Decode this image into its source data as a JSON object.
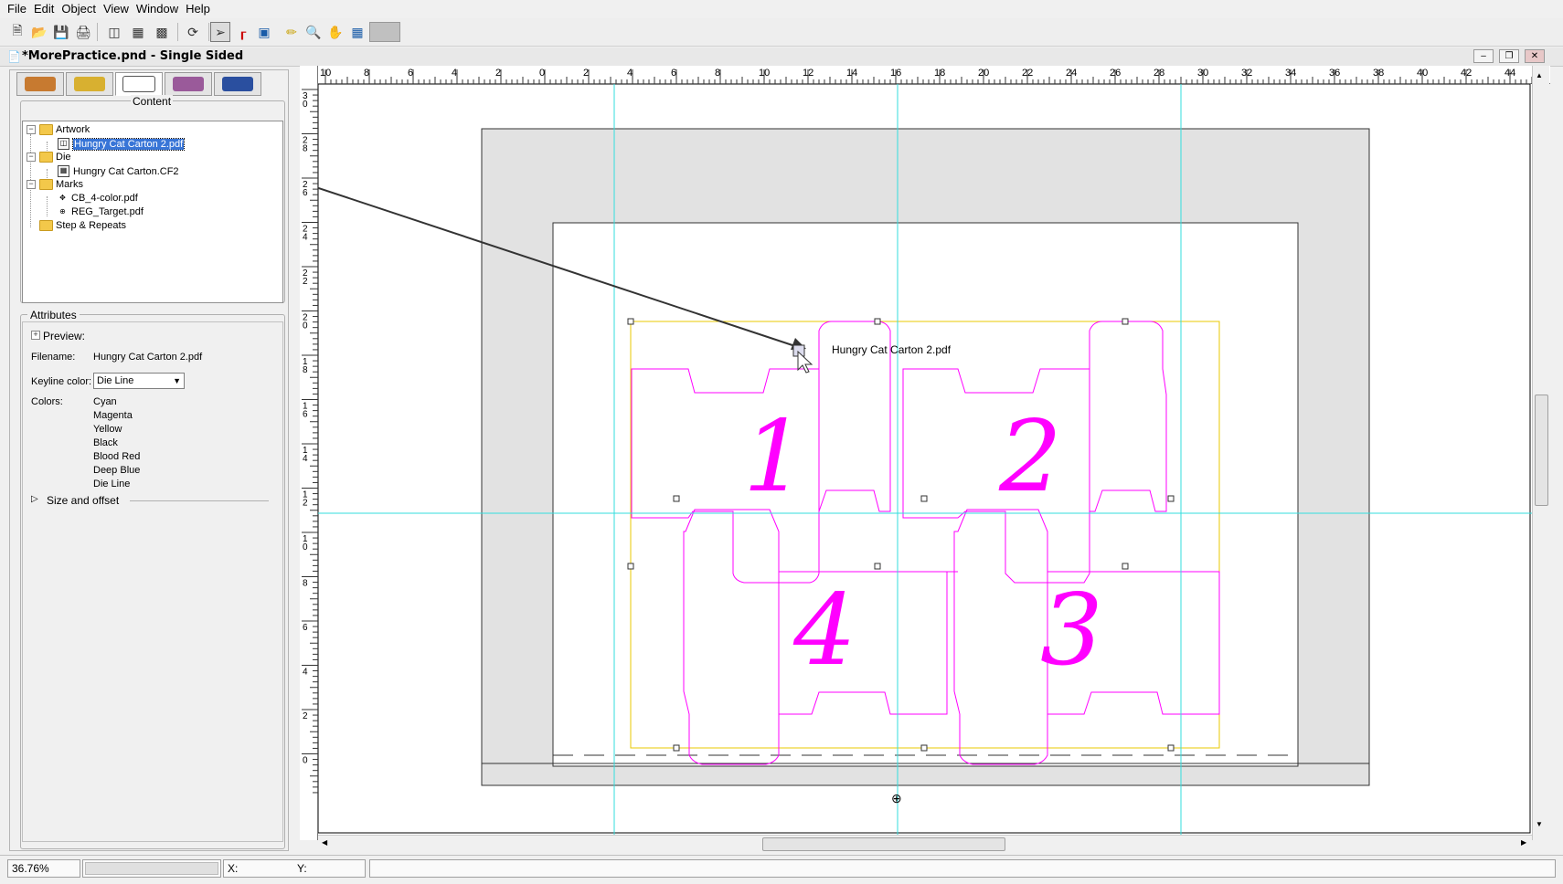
{
  "menu": [
    "File",
    "Edit",
    "Object",
    "View",
    "Window",
    "Help"
  ],
  "toolbar": {
    "icons": [
      "new-document-icon",
      "open-folder-icon",
      "save-icon",
      "print-icon",
      "artwork-icon",
      "die-icon",
      "mark-icon",
      "refresh-icon",
      "pointer-tool-icon",
      "crop-tool-icon",
      "align-tool-icon",
      "ruler-tool-icon",
      "zoom-tool-icon",
      "hand-tool-icon",
      "grid-tool-icon",
      "color-swatch-icon"
    ]
  },
  "document": {
    "title": "*MorePractice.pnd - Single Sided"
  },
  "panel_tabs": [
    "info-tab",
    "marks-tab",
    "content-tab",
    "layout-tab",
    "properties-tab"
  ],
  "content": {
    "legend": "Content",
    "tree": {
      "artwork": "Artwork",
      "artwork_file": "Hungry Cat Carton 2.pdf",
      "die": "Die",
      "die_file": "Hungry Cat Carton.CF2",
      "marks": "Marks",
      "mark1": "CB_4-color.pdf",
      "mark2": "REG_Target.pdf",
      "step": "Step & Repeats"
    }
  },
  "attributes": {
    "legend": "Attributes",
    "preview": "Preview:",
    "filename_label": "Filename:",
    "filename": "Hungry Cat Carton 2.pdf",
    "keyline_label": "Keyline color:",
    "keyline_value": "Die Line",
    "colors_label": "Colors:",
    "colors": [
      "Cyan",
      "Magenta",
      "Yellow",
      "Black",
      "Blood Red",
      "Deep Blue",
      "Die Line"
    ],
    "size_offset": "Size and offset"
  },
  "rulers": {
    "top": [
      "10",
      "8",
      "6",
      "4",
      "2",
      "0",
      "2",
      "4",
      "6",
      "8",
      "10",
      "12",
      "14",
      "16",
      "18",
      "20",
      "22",
      "24",
      "26",
      "28",
      "30",
      "32",
      "34",
      "36",
      "38",
      "40",
      "42",
      "44"
    ],
    "left": [
      "30",
      "28",
      "26",
      "24",
      "22",
      "20",
      "18",
      "16",
      "14",
      "12",
      "10",
      "8",
      "6",
      "4",
      "2",
      "0"
    ]
  },
  "canvas": {
    "drag_label": "Hungry Cat Carton 2.pdf",
    "numbers": [
      "1",
      "2",
      "3",
      "4"
    ],
    "colors": {
      "die": "#ff00ff",
      "guide": "#33dddd",
      "bbox": "#e8c800",
      "sheet": "#e2e2e2"
    }
  },
  "status": {
    "zoom": "36.76%",
    "x_label": "X:",
    "y_label": "Y:"
  }
}
